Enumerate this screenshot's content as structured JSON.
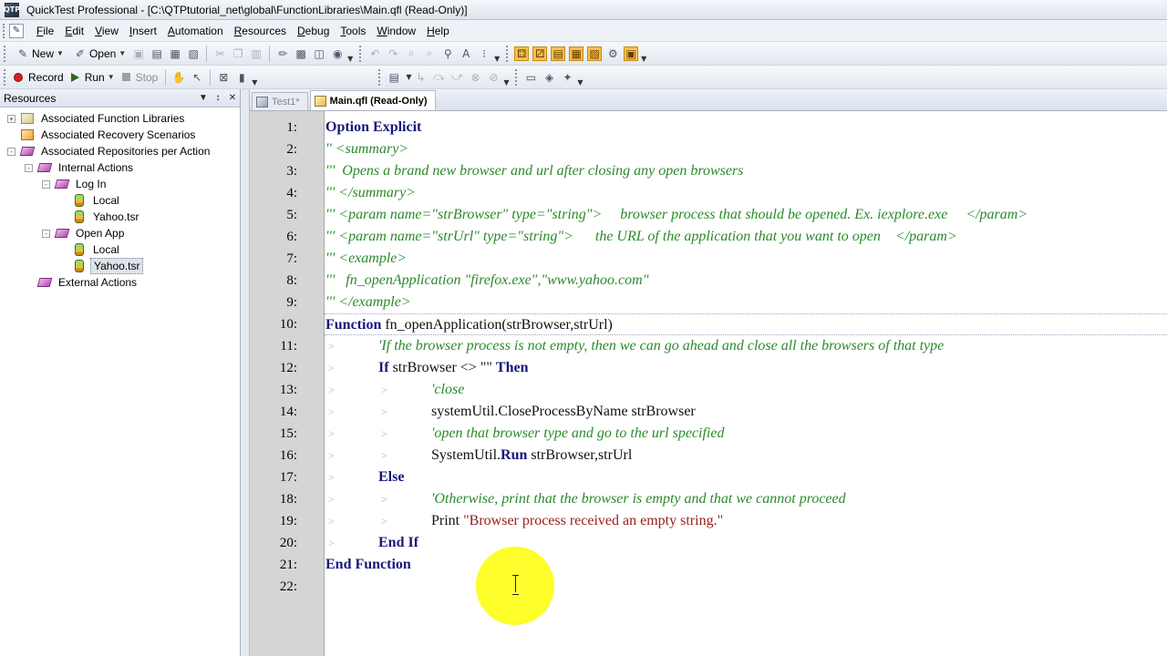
{
  "window": {
    "title": "QuickTest Professional - [C:\\QTPtutorial_net\\global\\FunctionLibraries\\Main.qfl  (Read-Only)]",
    "app_icon": "QTP"
  },
  "menu": {
    "items": [
      "File",
      "Edit",
      "View",
      "Insert",
      "Automation",
      "Resources",
      "Debug",
      "Tools",
      "Window",
      "Help"
    ]
  },
  "toolbar": {
    "new_label": "New",
    "open_label": "Open",
    "record_label": "Record",
    "run_label": "Run",
    "stop_label": "Stop"
  },
  "resources": {
    "title": "Resources",
    "pin": "▼",
    "pushpin": "↕",
    "close": "✕",
    "tree": [
      {
        "label": "Associated Function Libraries",
        "level": 0,
        "expander": "+",
        "icon": "library-icon"
      },
      {
        "label": "Associated Recovery Scenarios",
        "level": 0,
        "expander": "",
        "icon": "recovery-icon"
      },
      {
        "label": "Associated Repositories per Action",
        "level": 0,
        "expander": "-",
        "icon": "repository-icon"
      },
      {
        "label": "Internal Actions",
        "level": 1,
        "expander": "-",
        "icon": "repository-icon"
      },
      {
        "label": "Log In",
        "level": 2,
        "expander": "-",
        "icon": "repository-icon"
      },
      {
        "label": "Local",
        "level": 3,
        "expander": "",
        "icon": "object-repository-icon"
      },
      {
        "label": "Yahoo.tsr",
        "level": 3,
        "expander": "",
        "icon": "object-repository-icon"
      },
      {
        "label": "Open App",
        "level": 2,
        "expander": "-",
        "icon": "repository-icon"
      },
      {
        "label": "Local",
        "level": 3,
        "expander": "",
        "icon": "object-repository-icon"
      },
      {
        "label": "Yahoo.tsr",
        "level": 3,
        "expander": "",
        "icon": "object-repository-icon",
        "selected": true
      },
      {
        "label": "External Actions",
        "level": 1,
        "expander": "",
        "icon": "repository-icon"
      }
    ]
  },
  "tabs": [
    {
      "label": "Test1*",
      "active": false,
      "icon": "test-icon"
    },
    {
      "label": "Main.qfl  (Read-Only)",
      "active": true,
      "icon": "library-icon"
    }
  ],
  "editor": {
    "lines": [
      {
        "n": "1:",
        "indent": 0,
        "parts": [
          {
            "t": "kw",
            "s": "Option Explicit"
          }
        ]
      },
      {
        "n": "2:",
        "indent": 0,
        "parts": [
          {
            "t": "cm",
            "s": "'' <summary>"
          }
        ]
      },
      {
        "n": "3:",
        "indent": 0,
        "parts": [
          {
            "t": "cm",
            "s": "'''  Opens a brand new browser and url after closing any open browsers"
          }
        ]
      },
      {
        "n": "4:",
        "indent": 0,
        "parts": [
          {
            "t": "cm",
            "s": "''' </summary>"
          }
        ]
      },
      {
        "n": "5:",
        "indent": 0,
        "parts": [
          {
            "t": "cm",
            "s": "''' <param name=\"strBrowser\" type=\"string\">     browser process that should be opened. Ex. iexplore.exe     </param>"
          }
        ]
      },
      {
        "n": "6:",
        "indent": 0,
        "parts": [
          {
            "t": "cm",
            "s": "''' <param name=\"strUrl\" type=\"string\">      the URL of the application that you want to open    </param>"
          }
        ]
      },
      {
        "n": "7:",
        "indent": 0,
        "parts": [
          {
            "t": "cm",
            "s": "''' <example>"
          }
        ]
      },
      {
        "n": "8:",
        "indent": 0,
        "parts": [
          {
            "t": "cm",
            "s": "'''   fn_openApplication \"firefox.exe\",\"www.yahoo.com\""
          }
        ]
      },
      {
        "n": "9:",
        "indent": 0,
        "parts": [
          {
            "t": "cm",
            "s": "''' </example>"
          }
        ]
      },
      {
        "n": "10:",
        "indent": 0,
        "current": true,
        "parts": [
          {
            "t": "kw",
            "s": "Function"
          },
          {
            "t": "tx",
            "s": " fn_openApplication(strBrowser,strUrl)"
          }
        ]
      },
      {
        "n": "11:",
        "indent": 1,
        "parts": [
          {
            "t": "cm",
            "s": "'If the browser process is not empty, then we can go ahead and close all the browsers of that type"
          }
        ]
      },
      {
        "n": "12:",
        "indent": 1,
        "parts": [
          {
            "t": "kw",
            "s": "If"
          },
          {
            "t": "tx",
            "s": " strBrowser <> \"\" "
          },
          {
            "t": "kw",
            "s": "Then"
          }
        ]
      },
      {
        "n": "13:",
        "indent": 2,
        "parts": [
          {
            "t": "cm",
            "s": "'close"
          }
        ]
      },
      {
        "n": "14:",
        "indent": 2,
        "parts": [
          {
            "t": "tx",
            "s": "systemUtil.CloseProcessByName strBrowser"
          }
        ]
      },
      {
        "n": "15:",
        "indent": 2,
        "parts": [
          {
            "t": "cm",
            "s": "'open that browser type and go to the url specified"
          }
        ]
      },
      {
        "n": "16:",
        "indent": 2,
        "parts": [
          {
            "t": "tx",
            "s": "SystemUtil."
          },
          {
            "t": "kw",
            "s": "Run"
          },
          {
            "t": "tx",
            "s": " strBrowser,strUrl"
          }
        ]
      },
      {
        "n": "17:",
        "indent": 1,
        "parts": [
          {
            "t": "kw",
            "s": "Else"
          }
        ]
      },
      {
        "n": "18:",
        "indent": 2,
        "parts": [
          {
            "t": "cm",
            "s": "'Otherwise, print that the browser is empty and that we cannot proceed"
          }
        ]
      },
      {
        "n": "19:",
        "indent": 2,
        "parts": [
          {
            "t": "tx",
            "s": "Print "
          },
          {
            "t": "str",
            "s": "\"Browser process received an empty string.\""
          }
        ]
      },
      {
        "n": "20:",
        "indent": 1,
        "parts": [
          {
            "t": "kw",
            "s": "End If"
          }
        ]
      },
      {
        "n": "21:",
        "indent": 0,
        "parts": [
          {
            "t": "kw",
            "s": "End Function"
          }
        ]
      },
      {
        "n": "22:",
        "indent": 0,
        "parts": []
      }
    ]
  },
  "colors": {
    "keyword": "#18187a",
    "comment": "#2a8a2a",
    "string": "#9a1b1b",
    "gutter": "#d5d5d5",
    "cursor_highlight": "#ffff22"
  }
}
